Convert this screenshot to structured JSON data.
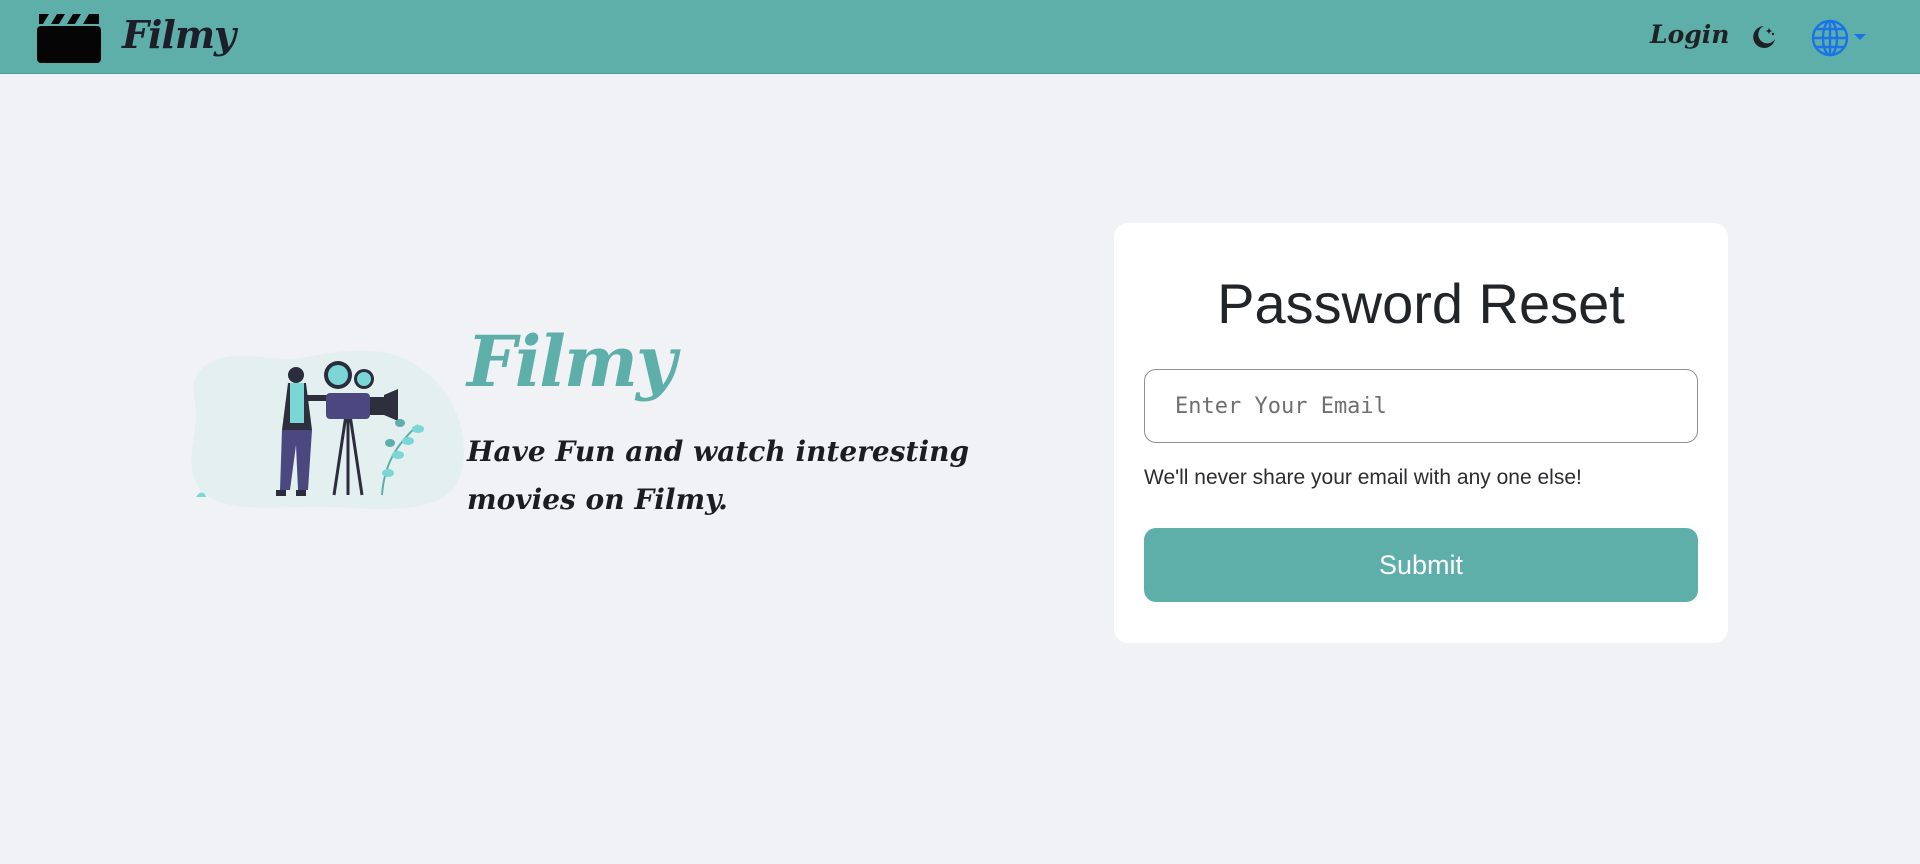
{
  "navbar": {
    "brand_text": "Filmy",
    "login_label": "Login",
    "theme_icon": "moon-stars-icon",
    "language_icon": "globe-icon",
    "background_color": "#5eafaa"
  },
  "hero": {
    "brand_text": "Filmy",
    "tagline": "Have Fun and watch interesting movies on Filmy.",
    "brand_color": "#5eafaa"
  },
  "reset_form": {
    "title": "Password Reset",
    "email_placeholder": "Enter Your Email",
    "email_value": "",
    "hint": "We'll never share your email with any one else!",
    "submit_label": "Submit",
    "button_color": "#5eafaa"
  }
}
